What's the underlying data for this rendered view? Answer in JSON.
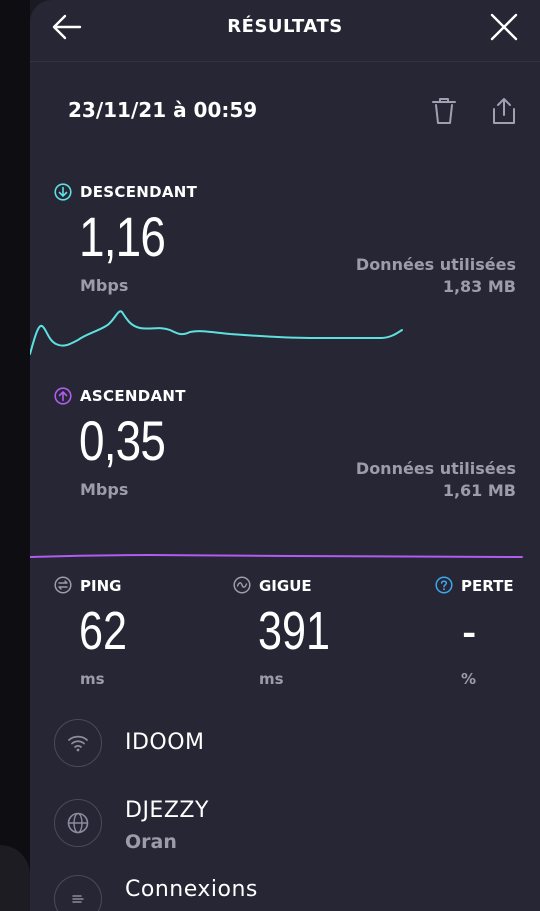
{
  "header": {
    "title": "RÉSULTATS"
  },
  "result": {
    "datetime": "23/11/21 à 00:59"
  },
  "download": {
    "label": "DESCENDANT",
    "value": "1,16",
    "unit": "Mbps",
    "data_used_label": "Données utilisées",
    "data_used_value": "1,83 MB",
    "color": "#5fe0e0"
  },
  "upload": {
    "label": "ASCENDANT",
    "value": "0,35",
    "unit": "Mbps",
    "data_used_label": "Données utilisées",
    "data_used_value": "1,61 MB",
    "color": "#b05cf0"
  },
  "stats": {
    "ping": {
      "label": "PING",
      "value": "62",
      "unit": "ms"
    },
    "jitter": {
      "label": "GIGUE",
      "value": "391",
      "unit": "ms"
    },
    "loss": {
      "label": "PERTE",
      "value": "-",
      "unit": "%"
    }
  },
  "provider": {
    "isp": "IDOOM",
    "server_name": "DJEZZY",
    "server_location": "Oran",
    "connections_label": "Connexions"
  },
  "icons": {
    "back": "arrow-left-icon",
    "close": "close-icon",
    "trash": "trash-icon",
    "share": "share-icon",
    "download": "download-icon",
    "upload": "upload-icon",
    "ping": "ping-icon",
    "jitter": "jitter-icon",
    "loss": "help-icon",
    "wifi": "wifi-icon",
    "globe": "globe-icon",
    "connections": "connections-icon"
  }
}
